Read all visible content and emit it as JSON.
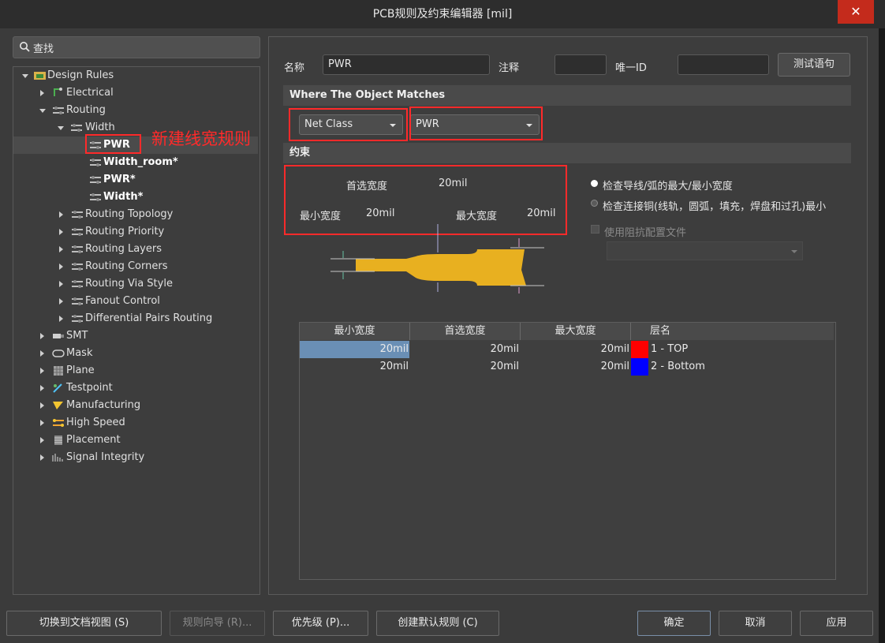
{
  "window": {
    "title": "PCB规则及约束编辑器 [mil]",
    "close": "✕"
  },
  "search": {
    "placeholder": "查找"
  },
  "tree": {
    "root": "Design Rules",
    "electrical": "Electrical",
    "routing": "Routing",
    "width": "Width",
    "rules": [
      "PWR",
      "Width_room*",
      "PWR*",
      "Width*"
    ],
    "routing_children": [
      "Routing Topology",
      "Routing Priority",
      "Routing Layers",
      "Routing Corners",
      "Routing Via Style",
      "Fanout Control",
      "Differential Pairs Routing"
    ],
    "categories": [
      "SMT",
      "Mask",
      "Plane",
      "Testpoint",
      "Manufacturing",
      "High Speed",
      "Placement",
      "Signal Integrity"
    ]
  },
  "annotation": "新建线宽规则",
  "rule": {
    "name_label": "名称",
    "name_value": "PWR",
    "comment_label": "注释",
    "comment_value": "",
    "uid_label": "唯一ID",
    "uid_value": "",
    "test_button": "测试语句"
  },
  "where": {
    "heading": "Where The Object Matches",
    "type_selected": "Net Class",
    "value_selected": "PWR"
  },
  "constraints": {
    "heading": "约束",
    "preferred_label": "首选宽度",
    "preferred_value": "20mil",
    "min_label": "最小宽度",
    "min_value": "20mil",
    "max_label": "最大宽度",
    "max_value": "20mil",
    "option1": "检查导线/弧的最大/最小宽度",
    "option2": "检查连接铜(线轨，圆弧，填充，焊盘和过孔)最小",
    "option3": "使用阻抗配置文件"
  },
  "layer_table": {
    "headers": [
      "最小宽度",
      "首选宽度",
      "最大宽度",
      "层名"
    ],
    "rows": [
      {
        "min": "20mil",
        "pref": "20mil",
        "max": "20mil",
        "color": "#ff0000",
        "layer": "1 - TOP"
      },
      {
        "min": "20mil",
        "pref": "20mil",
        "max": "20mil",
        "color": "#0000ff",
        "layer": "2 - Bottom"
      }
    ]
  },
  "buttons": {
    "doc_view": "切换到文档视图 (S)",
    "wizard": "规则向导 (R)...",
    "priority": "优先级 (P)...",
    "create_default": "创建默认规则 (C)",
    "ok": "确定",
    "cancel": "取消",
    "apply": "应用"
  },
  "colors": {
    "accent_red": "#ff2a2a",
    "trace_yellow": "#e8b020",
    "selection_blue": "#6a8fb5"
  }
}
